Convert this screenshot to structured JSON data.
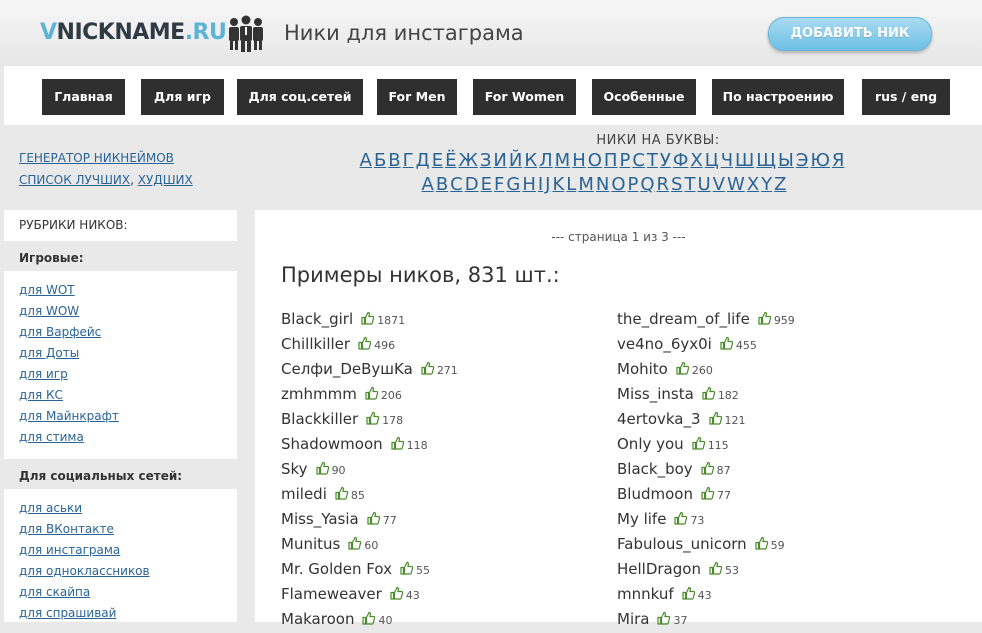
{
  "header": {
    "logo_light": "V",
    "logo_dark": "NICKNAME",
    "logo_domain": ".RU",
    "title": "Ники для инстаграма",
    "add_button": "ДОБАВИТЬ НИК"
  },
  "nav": {
    "items": [
      {
        "label": "Главная"
      },
      {
        "label": "Для игр"
      },
      {
        "label": "Для соц.сетей"
      },
      {
        "label": "For Men"
      },
      {
        "label": "For Women"
      },
      {
        "label": "Особенные"
      },
      {
        "label": "По настроению"
      },
      {
        "label": "rus / eng"
      }
    ]
  },
  "gen_links": {
    "generator": "ГЕНЕРАТОР НИКНЕЙМОВ",
    "best": "СПИСОК ЛУЧШИХ",
    "sep": ",",
    "worst": "ХУДШИХ"
  },
  "letters": {
    "title": "НИКИ НА БУКВЫ:",
    "cyrillic": [
      "А",
      "Б",
      "В",
      "Г",
      "Д",
      "Е",
      "Ё",
      "Ж",
      "З",
      "И",
      "Й",
      "К",
      "Л",
      "М",
      "Н",
      "О",
      "П",
      "Р",
      "С",
      "Т",
      "У",
      "Ф",
      "Х",
      "Ц",
      "Ч",
      "Ш",
      "Щ",
      "Ы",
      "Э",
      "Ю",
      "Я"
    ],
    "latin": [
      "A",
      "B",
      "C",
      "D",
      "E",
      "F",
      "G",
      "H",
      "I",
      "J",
      "K",
      "L",
      "M",
      "N",
      "O",
      "P",
      "Q",
      "R",
      "S",
      "T",
      "U",
      "V",
      "W",
      "X",
      "Y",
      "Z"
    ]
  },
  "sidebar": {
    "rubrics_title": "РУБРИКИ НИКОВ:",
    "games_title": "Игровые:",
    "games": [
      "для WOT",
      "для WOW",
      "для Варфейс",
      "для Доты",
      "для игр",
      "для КС",
      "для Майнкрафт",
      "для стима"
    ],
    "social_title": "Для социальных сетей:",
    "social": [
      "для аськи",
      "для ВКонтакте",
      "для инстаграма",
      "для одноклассников",
      "для скайпа",
      "для спрашивай"
    ]
  },
  "main": {
    "pager": "--- страница 1 из 3 ---",
    "title": "Примеры ников, 831 шт.:",
    "left": [
      {
        "name": "Black_girl",
        "likes": "1871"
      },
      {
        "name": "Chillkiller",
        "likes": "496"
      },
      {
        "name": "Ceлфи_DeBушKa",
        "likes": "271"
      },
      {
        "name": "zmhmmm",
        "likes": "206"
      },
      {
        "name": "Blackkiller",
        "likes": "178"
      },
      {
        "name": "Shadowmoon",
        "likes": "118"
      },
      {
        "name": "Sky",
        "likes": "90"
      },
      {
        "name": "miledi",
        "likes": "85"
      },
      {
        "name": "Miss_Yasia",
        "likes": "77"
      },
      {
        "name": "Munitus",
        "likes": "60"
      },
      {
        "name": "Mr. Golden Fox",
        "likes": "55"
      },
      {
        "name": "Flameweaver",
        "likes": "43"
      },
      {
        "name": "Makaroon",
        "likes": "40"
      }
    ],
    "right": [
      {
        "name": "the_dream_of_life",
        "likes": "959"
      },
      {
        "name": "ve4no_6yx0i",
        "likes": "455"
      },
      {
        "name": "Mohito",
        "likes": "260"
      },
      {
        "name": "Miss_insta",
        "likes": "182"
      },
      {
        "name": "4ertovka_3",
        "likes": "121"
      },
      {
        "name": "Only you",
        "likes": "115"
      },
      {
        "name": "Black_boy",
        "likes": "87"
      },
      {
        "name": "Bludmoon",
        "likes": "77"
      },
      {
        "name": "My life",
        "likes": "73"
      },
      {
        "name": "Fabulous_unicorn",
        "likes": "59"
      },
      {
        "name": "HellDragon",
        "likes": "53"
      },
      {
        "name": "mnnkuf",
        "likes": "43"
      },
      {
        "name": "Mira",
        "likes": "37"
      }
    ]
  }
}
